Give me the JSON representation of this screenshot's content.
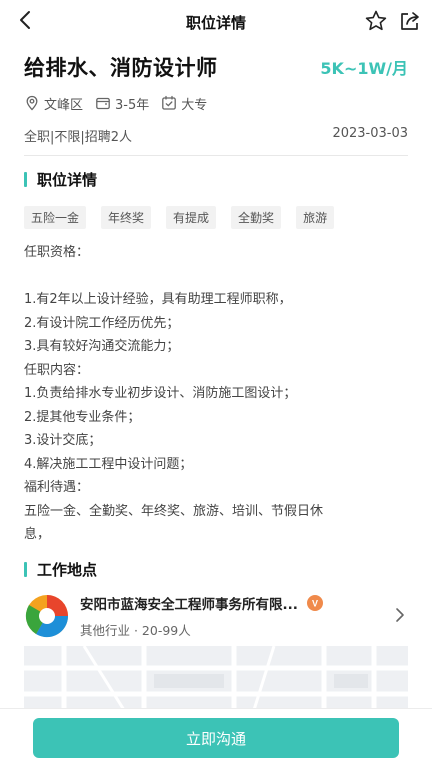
{
  "nav": {
    "title": "职位详情"
  },
  "job": {
    "title": "给排水、消防设计师",
    "salary": "5K~1W/月",
    "location": "文峰区",
    "experience": "3-5年",
    "education": "大专",
    "type_info": "全职|不限|招聘2人",
    "date": "2023-03-03"
  },
  "details_section": {
    "title": "职位详情"
  },
  "tags": [
    "五险一金",
    "年终奖",
    "有提成",
    "全勤奖",
    "旅游"
  ],
  "description": [
    "任职资格：",
    "",
    "1.有2年以上设计经验，具有助理工程师职称，",
    "2.有设计院工作经历优先；",
    "3.具有较好沟通交流能力；",
    "任职内容：",
    "1.负责给排水专业初步设计、消防施工图设计；",
    "2.提其他专业条件；",
    "3.设计交底；",
    "4.解决施工工程中设计问题；",
    "福利待遇：",
    "五险一金、全勤奖、年终奖、旅游、培训、节假日休",
    "息，"
  ],
  "work_section": {
    "title": "工作地点"
  },
  "company": {
    "name": "安阳市蓝海安全工程师事务所有限...",
    "sub": "其他行业 · 20-99人",
    "badge": "V"
  },
  "cta": {
    "label": "立即沟通"
  },
  "colors": {
    "accent": "#3cc3b6"
  }
}
